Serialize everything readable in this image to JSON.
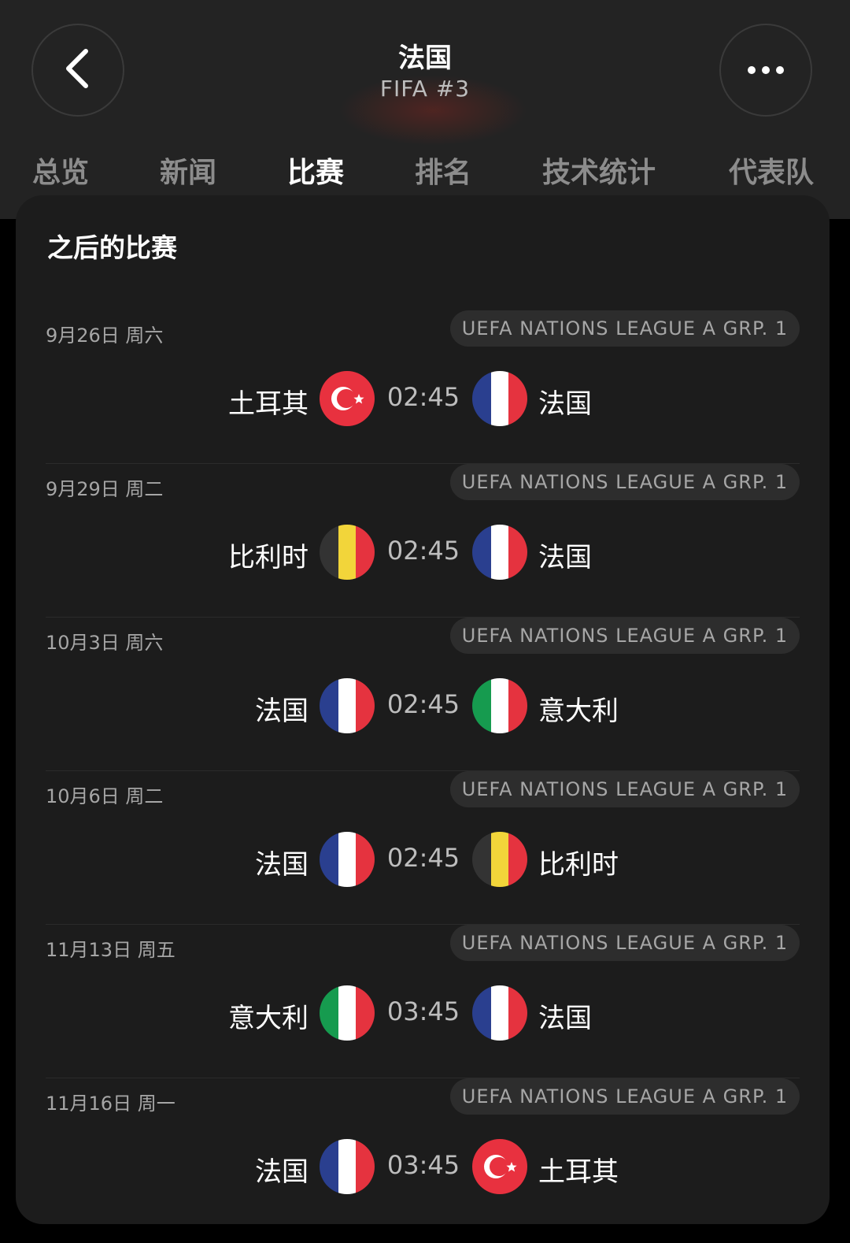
{
  "header": {
    "title": "法国",
    "subtitle": "FIFA #3",
    "back_icon": "chevron-left-icon",
    "more_icon": "ellipsis-icon"
  },
  "tabs": [
    {
      "label": "总览",
      "active": false
    },
    {
      "label": "新闻",
      "active": false
    },
    {
      "label": "比赛",
      "active": true
    },
    {
      "label": "排名",
      "active": false
    },
    {
      "label": "技术统计",
      "active": false
    },
    {
      "label": "代表队",
      "active": false
    }
  ],
  "section": {
    "title": "之后的比赛"
  },
  "matches": [
    {
      "date": "9月26日 周六",
      "competition": "UEFA NATIONS LEAGUE A GRP. 1",
      "home": "土耳其",
      "home_flag": "turkey",
      "time": "02:45",
      "away": "法国",
      "away_flag": "france"
    },
    {
      "date": "9月29日 周二",
      "competition": "UEFA NATIONS LEAGUE A GRP. 1",
      "home": "比利时",
      "home_flag": "belgium",
      "time": "02:45",
      "away": "法国",
      "away_flag": "france"
    },
    {
      "date": "10月3日 周六",
      "competition": "UEFA NATIONS LEAGUE A GRP. 1",
      "home": "法国",
      "home_flag": "france",
      "time": "02:45",
      "away": "意大利",
      "away_flag": "italy"
    },
    {
      "date": "10月6日 周二",
      "competition": "UEFA NATIONS LEAGUE A GRP. 1",
      "home": "法国",
      "home_flag": "france",
      "time": "02:45",
      "away": "比利时",
      "away_flag": "belgium"
    },
    {
      "date": "11月13日 周五",
      "competition": "UEFA NATIONS LEAGUE A GRP. 1",
      "home": "意大利",
      "home_flag": "italy",
      "time": "03:45",
      "away": "法国",
      "away_flag": "france"
    },
    {
      "date": "11月16日 周一",
      "competition": "UEFA NATIONS LEAGUE A GRP. 1",
      "home": "法国",
      "home_flag": "france",
      "time": "03:45",
      "away": "土耳其",
      "away_flag": "turkey"
    }
  ],
  "colors": {
    "background": "#000000",
    "header": "#232323",
    "card": "#1c1c1c",
    "pill": "#2d2d2d",
    "text_primary": "#ffffff",
    "text_secondary": "#a6a6a6"
  }
}
